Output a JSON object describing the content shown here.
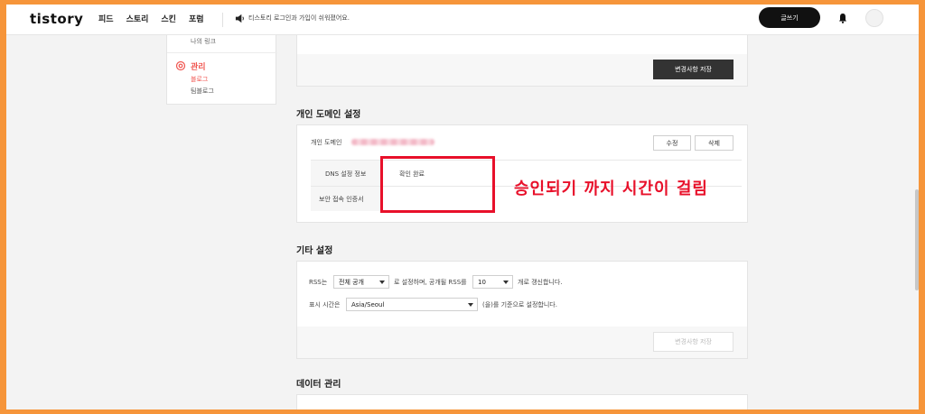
{
  "header": {
    "logo": "tistory",
    "nav": [
      "피드",
      "스토리",
      "스킨",
      "포럼"
    ],
    "notice": "티스토리 로그인과 가입이 쉬워졌어요.",
    "write_button": "글쓰기"
  },
  "sidebar": {
    "my_link": "나의 링크",
    "manage": "관리",
    "blog": "블로그",
    "tistory": "팀블로그"
  },
  "top_panel": {
    "save_button": "변경사항 저장"
  },
  "domain_section": {
    "title": "개인 도메인 설정",
    "domain_label": "개인 도메인",
    "edit_button": "수정",
    "delete_button": "삭제",
    "dns_label": "DNS 설정 정보",
    "dns_value": "확인 완료",
    "ssl_label": "보안 접속 인증서"
  },
  "annotation": "승인되기 까지 시간이 걸림",
  "etc_section": {
    "title": "기타 설정",
    "rss_prefix": "RSS는",
    "rss_select": "전체 공개",
    "rss_mid": "로 설정하며, 공개될 RSS를",
    "rss_count": "10",
    "rss_suffix": "개로 갱신합니다.",
    "time_label": "표시 시간은",
    "time_select": "Asia/Seoul",
    "time_suffix": "(을)를 기준으로 설정합니다.",
    "save_button": "변경사항 저장"
  },
  "data_section": {
    "title": "데이터 관리"
  },
  "colors": {
    "border_frame": "#f6953a",
    "accent": "#f05650",
    "annotation": "#e8102a"
  }
}
